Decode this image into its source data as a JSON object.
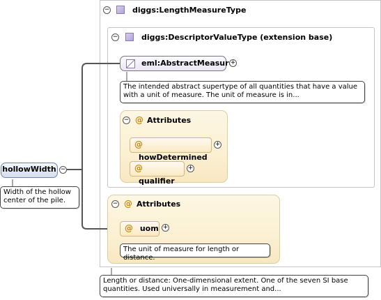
{
  "root": {
    "label": "hollowWidth",
    "doc": "Width of the hollow center of the pile."
  },
  "length_type": {
    "label": "diggs:LengthMeasureType",
    "doc": "Length or distance: One-dimensional extent. One of the seven SI base quantities. Used universally in measurement and..."
  },
  "descriptor_type": {
    "label": "diggs:DescriptorValueType (extension base)"
  },
  "abstract_measure": {
    "label": "eml:AbstractMeasure",
    "doc": "The intended abstract supertype of all quantities that have a value with a unit of measure. The unit of measure is in..."
  },
  "inner_attributes": {
    "label": "Attributes",
    "items": [
      {
        "label": "howDetermined"
      },
      {
        "label": "qualifier"
      }
    ]
  },
  "outer_attributes": {
    "label": "Attributes",
    "items": [
      {
        "label": "uom",
        "doc": "The unit of measure for length or distance."
      }
    ]
  },
  "symbols": {
    "collapse": "⊖",
    "expand": "+",
    "minus": "−",
    "attribute": "@"
  },
  "colors": {
    "element_fill": "#d4ddec",
    "attribute_fill": "#fbe9c3",
    "type_icon": "#b3a3da"
  }
}
